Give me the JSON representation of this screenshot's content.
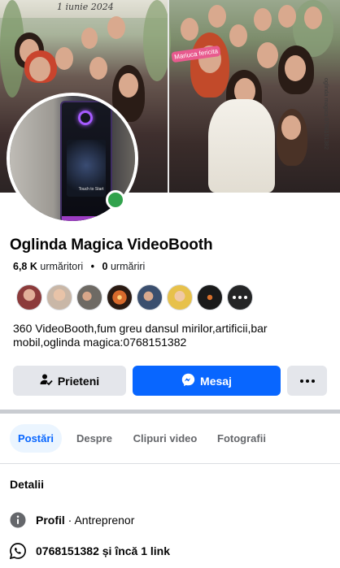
{
  "cover": {
    "date_text": "1 iunie 2024",
    "sign_text": "Mariuca fericita",
    "side_text": "oglinda magica 0768151382"
  },
  "avatar": {
    "booth_text": "Touch to Start",
    "online": true
  },
  "profile": {
    "name": "Oglinda Magica VideoBooth",
    "followers_count": "6,8 K",
    "followers_label": "urmăritori",
    "following_count": "0",
    "following_label": "urmăriri",
    "bio": "360 VideoBooth,fum greu dansul mirilor,artificii,bar mobil,oglinda magica:0768151382"
  },
  "follower_avatars": [
    {
      "name": "follower-avatar-1",
      "color": "#8c3b3b"
    },
    {
      "name": "follower-avatar-2",
      "color": "#c9b7a7"
    },
    {
      "name": "follower-avatar-3",
      "color": "#6e6a64"
    },
    {
      "name": "follower-avatar-4",
      "color": "#d86a2c"
    },
    {
      "name": "follower-avatar-5",
      "color": "#3b4f6e"
    },
    {
      "name": "follower-avatar-6",
      "color": "#e7c14b"
    },
    {
      "name": "follower-avatar-7",
      "color": "#1a1a1a"
    }
  ],
  "actions": {
    "friends_label": "Prieteni",
    "message_label": "Mesaj"
  },
  "tabs": [
    {
      "label": "Postări",
      "active": true
    },
    {
      "label": "Despre",
      "active": false
    },
    {
      "label": "Clipuri video",
      "active": false
    },
    {
      "label": "Fotografii",
      "active": false
    }
  ],
  "details": {
    "title": "Detalii",
    "profile_label": "Profil",
    "profile_value": " · Antreprenor",
    "phone_text": "0768151382 și încă 1 link"
  },
  "colors": {
    "brand_blue": "#0866ff",
    "online_green": "#31a24c",
    "button_gray": "#e4e6eb"
  }
}
